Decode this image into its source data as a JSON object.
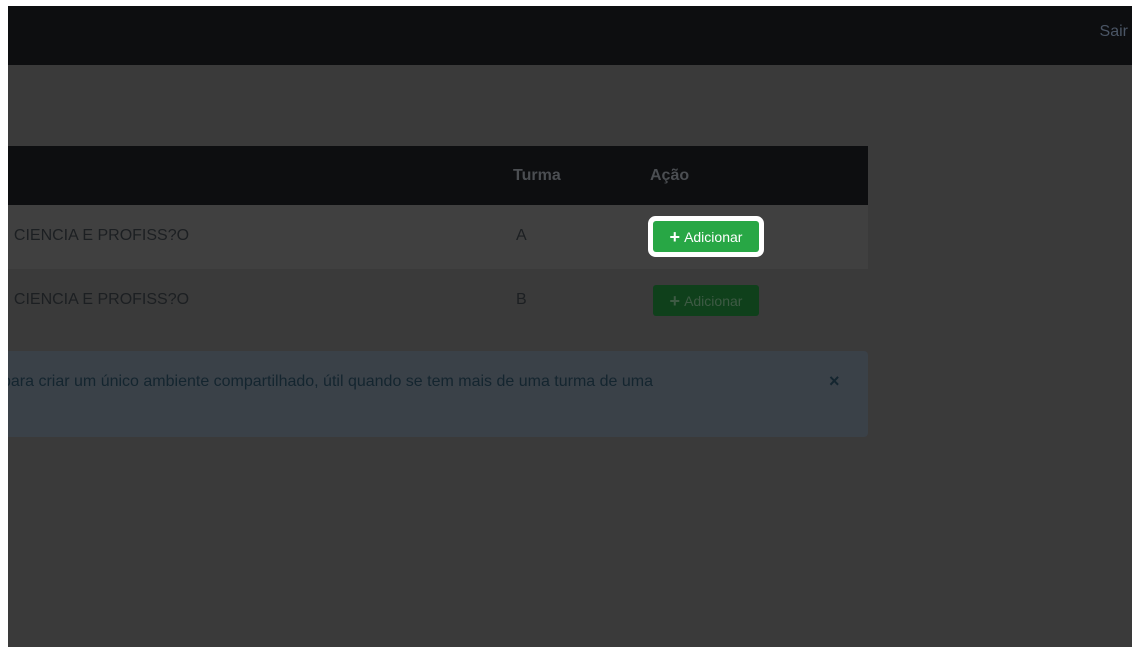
{
  "header": {
    "logout_label": "Sair"
  },
  "table": {
    "columns": {
      "turma": "Turma",
      "acao": "Ação"
    },
    "rows": [
      {
        "name": ": CIENCIA E PROFISS?O",
        "turma": "A",
        "action_label": "Adicionar"
      },
      {
        "name": ": CIENCIA E PROFISS?O",
        "turma": "B",
        "action_label": "Adicionar"
      }
    ]
  },
  "alert": {
    "text": "para criar um único ambiente compartilhado, útil quando se tem mais de uma turma de uma",
    "close_symbol": "×"
  },
  "icons": {
    "plus": "+"
  },
  "colors": {
    "button_primary": "#28a745",
    "overlay": "#3a3a3a",
    "header": "#0d0e10"
  }
}
